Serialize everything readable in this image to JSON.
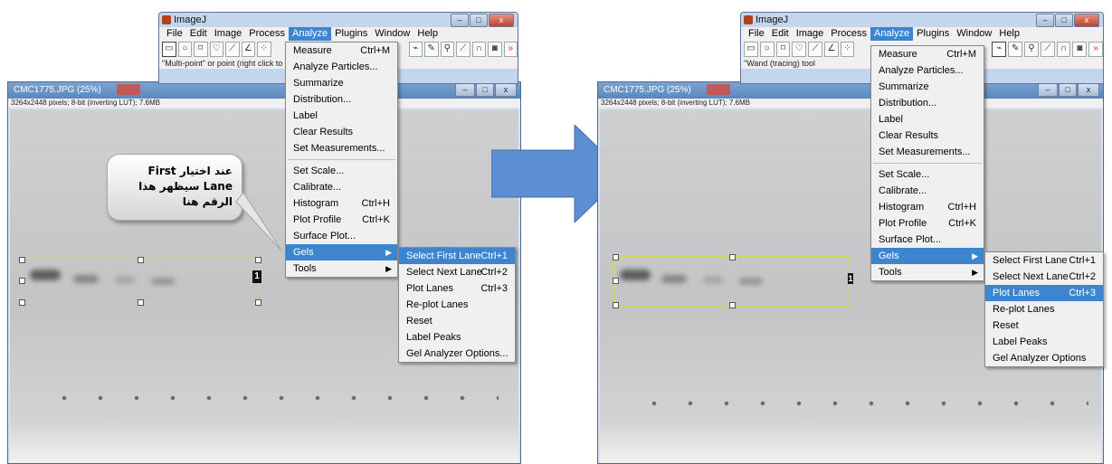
{
  "left_panel": {
    "toolbar_window": {
      "title": "ImageJ",
      "menus": [
        "File",
        "Edit",
        "Image",
        "Process",
        "Analyze",
        "Plugins",
        "Window",
        "Help"
      ],
      "active_menu": "Analyze",
      "status_text": "\"Multi-point\" or point (right click to"
    },
    "image_window": {
      "title": "CMC1775.JPG (25%)",
      "info": "3264x2448 pixels; 8-bit (inverting LUT); 7.6MB"
    },
    "analyze_menu": [
      {
        "label": "Measure",
        "shortcut": "Ctrl+M"
      },
      {
        "label": "Analyze Particles...",
        "shortcut": ""
      },
      {
        "label": "Summarize",
        "shortcut": ""
      },
      {
        "label": "Distribution...",
        "shortcut": ""
      },
      {
        "label": "Label",
        "shortcut": ""
      },
      {
        "label": "Clear Results",
        "shortcut": ""
      },
      {
        "label": "Set Measurements...",
        "shortcut": ""
      },
      {
        "label": "Set Scale...",
        "shortcut": ""
      },
      {
        "label": "Calibrate...",
        "shortcut": ""
      },
      {
        "label": "Histogram",
        "shortcut": "Ctrl+H"
      },
      {
        "label": "Plot Profile",
        "shortcut": "Ctrl+K"
      },
      {
        "label": "Surface Plot...",
        "shortcut": ""
      },
      {
        "label": "Gels",
        "shortcut": ""
      },
      {
        "label": "Tools",
        "shortcut": ""
      }
    ],
    "gels_submenu": [
      {
        "label": "Select First Lane",
        "shortcut": "Ctrl+1"
      },
      {
        "label": "Select Next Lane",
        "shortcut": "Ctrl+2"
      },
      {
        "label": "Plot Lanes",
        "shortcut": "Ctrl+3"
      },
      {
        "label": "Re-plot Lanes",
        "shortcut": ""
      },
      {
        "label": "Reset",
        "shortcut": ""
      },
      {
        "label": "Label Peaks",
        "shortcut": ""
      },
      {
        "label": "Gel Analyzer Options...",
        "shortcut": ""
      }
    ],
    "highlighted_submenu_item": "Select First Lane",
    "lane_number": "1",
    "callout_text": "عند اختيار First Lane سيظهر هذا الرقم هنا"
  },
  "right_panel": {
    "toolbar_window": {
      "title": "ImageJ",
      "menus": [
        "File",
        "Edit",
        "Image",
        "Process",
        "Analyze",
        "Plugins",
        "Window",
        "Help"
      ],
      "active_menu": "Analyze",
      "status_text": "\"Wand (tracing) tool"
    },
    "image_window": {
      "title": "CMC1775.JPG (25%)",
      "info": "3264x2448 pixels; 8-bit (inverting LUT); 7.6MB"
    },
    "analyze_menu": [
      {
        "label": "Measure",
        "shortcut": "Ctrl+M"
      },
      {
        "label": "Analyze Particles...",
        "shortcut": ""
      },
      {
        "label": "Summarize",
        "shortcut": ""
      },
      {
        "label": "Distribution...",
        "shortcut": ""
      },
      {
        "label": "Label",
        "shortcut": ""
      },
      {
        "label": "Clear Results",
        "shortcut": ""
      },
      {
        "label": "Set Measurements...",
        "shortcut": ""
      },
      {
        "label": "Set Scale...",
        "shortcut": ""
      },
      {
        "label": "Calibrate...",
        "shortcut": ""
      },
      {
        "label": "Histogram",
        "shortcut": "Ctrl+H"
      },
      {
        "label": "Plot Profile",
        "shortcut": "Ctrl+K"
      },
      {
        "label": "Surface Plot...",
        "shortcut": ""
      },
      {
        "label": "Gels",
        "shortcut": ""
      },
      {
        "label": "Tools",
        "shortcut": ""
      }
    ],
    "gels_submenu": [
      {
        "label": "Select First Lane",
        "shortcut": "Ctrl+1"
      },
      {
        "label": "Select Next Lane",
        "shortcut": "Ctrl+2"
      },
      {
        "label": "Plot Lanes",
        "shortcut": "Ctrl+3"
      },
      {
        "label": "Re-plot Lanes",
        "shortcut": ""
      },
      {
        "label": "Reset",
        "shortcut": ""
      },
      {
        "label": "Label Peaks",
        "shortcut": ""
      },
      {
        "label": "Gel Analyzer Options",
        "shortcut": ""
      }
    ],
    "highlighted_submenu_item": "Plot Lanes",
    "lane_number": "1"
  },
  "colors": {
    "menu_highlight": "#3d86cf",
    "arrow": "#5b8fd1",
    "selection": "#d8d84a"
  }
}
